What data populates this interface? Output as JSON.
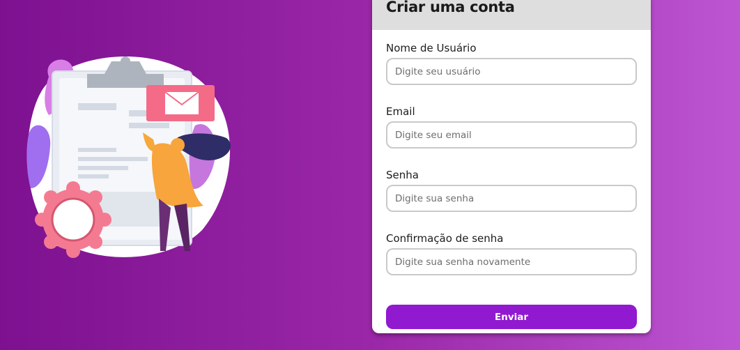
{
  "form": {
    "title": "Criar uma conta",
    "fields": [
      {
        "label": "Nome de Usuário",
        "placeholder": "Digite seu usuário",
        "value": ""
      },
      {
        "label": "Email",
        "placeholder": "Digite seu email",
        "value": ""
      },
      {
        "label": "Senha",
        "placeholder": "Digite sua senha",
        "value": ""
      },
      {
        "label": "Confirmação de senha",
        "placeholder": "Digite sua senha novamente",
        "value": ""
      }
    ],
    "submit_label": "Enviar"
  },
  "colors": {
    "background_start": "#7d1190",
    "background_end": "#bd55d2",
    "accent": "#9119cf",
    "header_bg": "#dedede"
  },
  "illustration": {
    "icon_names": [
      "clipboard-icon",
      "envelope-icon",
      "gear-icon",
      "person-icon"
    ]
  }
}
